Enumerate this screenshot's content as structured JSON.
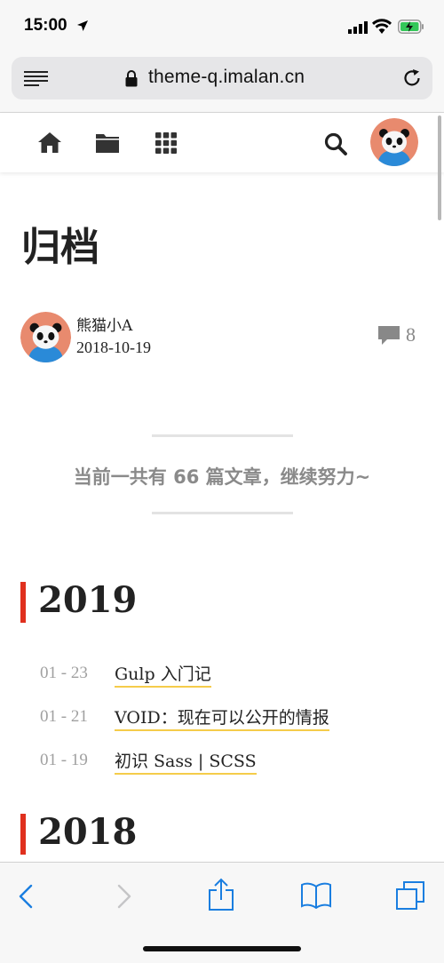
{
  "status_bar": {
    "time": "15:00",
    "colors": {
      "battery_fill": "#34c759"
    }
  },
  "browser": {
    "domain": "theme-q.imalan.cn",
    "accent": "#1a7ee0"
  },
  "site_nav": {
    "icons": [
      "home-icon",
      "folder-icon",
      "grid-icon",
      "search-icon",
      "avatar"
    ]
  },
  "page": {
    "title": "归档",
    "author": {
      "name": "熊猫小A",
      "date": "2018-10-19"
    },
    "comments": {
      "count": "8"
    },
    "summary": "当前一共有 66 篇文章，继续努力~"
  },
  "archive": [
    {
      "year": "2019",
      "posts": [
        {
          "date": "01 - 23",
          "title": "Gulp 入门记"
        },
        {
          "date": "01 - 21",
          "title": "VOID：现在可以公开的情报"
        },
        {
          "date": "01 - 19",
          "title": "初识 Sass | SCSS"
        }
      ]
    },
    {
      "year": "2018",
      "posts": []
    }
  ],
  "colors": {
    "year_bar": "#e0301e",
    "link_underline": "#f5cc4a",
    "muted_text": "#8a8a8a"
  }
}
